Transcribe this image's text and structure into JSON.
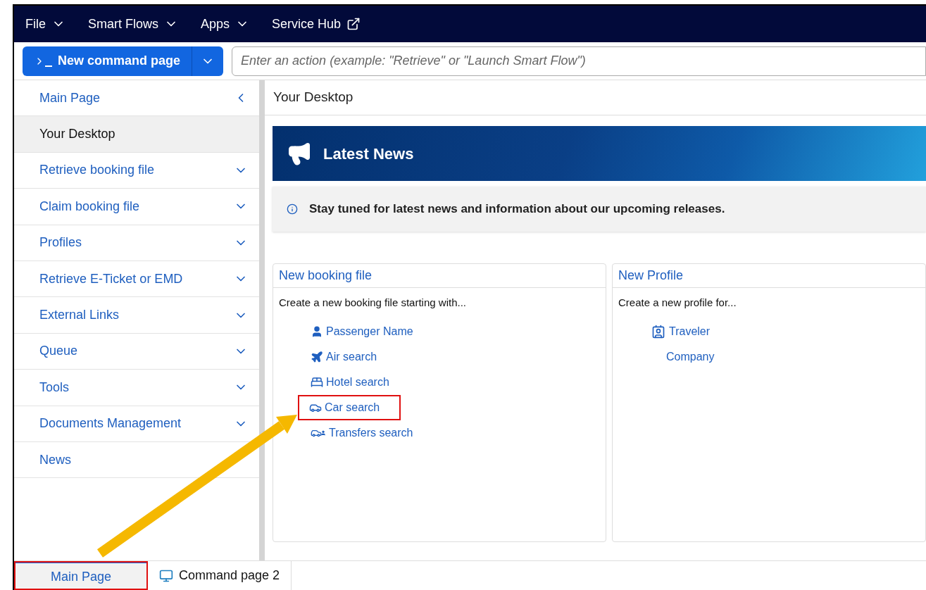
{
  "menu_bar": [
    {
      "label": "File",
      "kind": "dropdown"
    },
    {
      "label": "Smart Flows",
      "kind": "dropdown"
    },
    {
      "label": "Apps",
      "kind": "dropdown"
    },
    {
      "label": "Service Hub",
      "kind": "external"
    }
  ],
  "toolbar": {
    "new_button": "New command page",
    "action_field": {
      "placeholder": "Enter an action (example: \"Retrieve\" or \"Launch Smart Flow\")"
    }
  },
  "sidebar": {
    "items": [
      {
        "label": "Main Page",
        "kind": "header",
        "selected": false
      },
      {
        "label": "Your Desktop",
        "kind": "link",
        "selected": true
      },
      {
        "label": "Retrieve booking file",
        "kind": "group",
        "selected": false
      },
      {
        "label": "Claim booking file",
        "kind": "group",
        "selected": false
      },
      {
        "label": "Profiles",
        "kind": "group",
        "selected": false
      },
      {
        "label": "Retrieve E-Ticket or EMD",
        "kind": "group",
        "selected": false
      },
      {
        "label": "External Links",
        "kind": "group",
        "selected": false
      },
      {
        "label": "Queue",
        "kind": "group",
        "selected": false
      },
      {
        "label": "Tools",
        "kind": "group",
        "selected": false
      },
      {
        "label": "Documents Management",
        "kind": "group",
        "selected": false
      },
      {
        "label": "News",
        "kind": "link",
        "selected": false
      }
    ]
  },
  "main": {
    "title": "Your Desktop",
    "news_banner": {
      "title": "Latest News"
    },
    "info": "Stay tuned for latest news and information about our upcoming releases.",
    "cards": [
      {
        "title": "New booking file",
        "subtitle": "Create a new booking file starting with...",
        "links": [
          {
            "label": "Passenger Name",
            "kind": "person",
            "highlighted": false
          },
          {
            "label": "Air search",
            "kind": "plane",
            "highlighted": false
          },
          {
            "label": "Hotel search",
            "kind": "bed",
            "highlighted": false
          },
          {
            "label": "Car search",
            "kind": "car",
            "highlighted": true
          },
          {
            "label": "Transfers search",
            "kind": "transfer",
            "highlighted": false
          }
        ]
      },
      {
        "title": "New Profile",
        "subtitle": "Create a new profile for...",
        "links": [
          {
            "label": "Traveler",
            "kind": "traveler",
            "highlighted": false
          },
          {
            "label": "Company",
            "kind": "company",
            "highlighted": false
          }
        ]
      }
    ]
  },
  "bottom_tabs": [
    {
      "label": "Main Page",
      "selected": true,
      "highlighted": true,
      "kind": "main"
    },
    {
      "label": "Command page 2",
      "selected": false,
      "highlighted": false,
      "kind": "command"
    }
  ]
}
